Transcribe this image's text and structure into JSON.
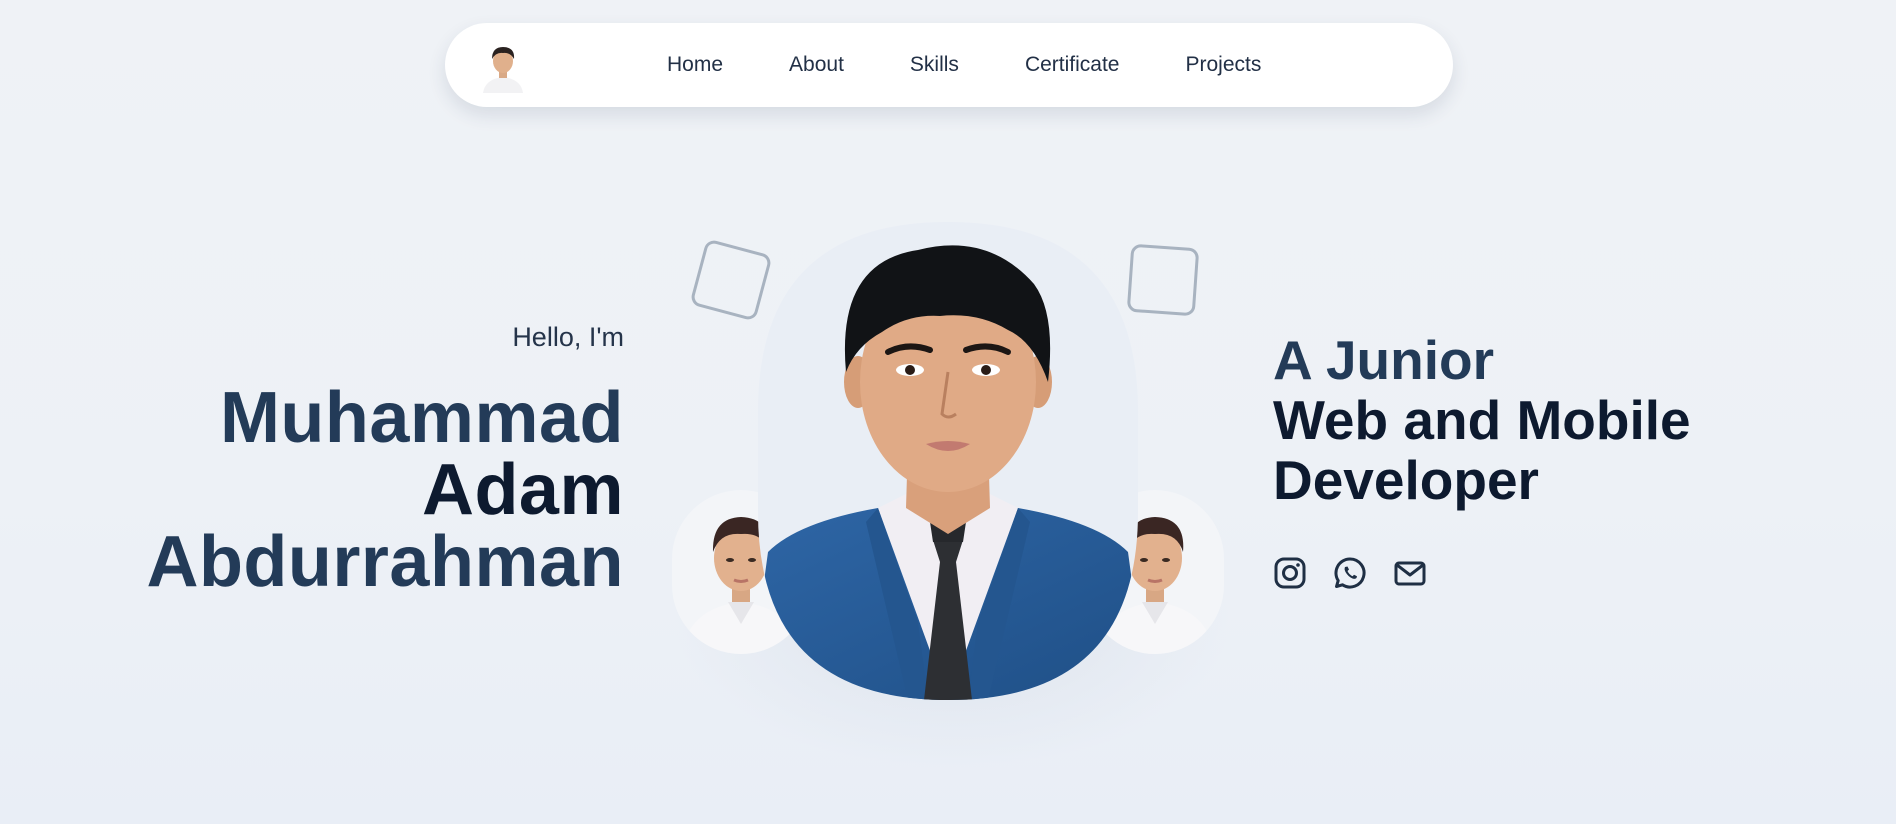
{
  "nav": {
    "avatar_icon": "profile-photo",
    "links": [
      "Home",
      "About",
      "Skills",
      "Certificate",
      "Projects"
    ]
  },
  "hero": {
    "greeting": "Hello, I'm",
    "name": {
      "first": "Muhammad",
      "middle": "Adam",
      "last": "Abdurrahman"
    },
    "role": {
      "line1": "A Junior",
      "line2": "Web and Mobile",
      "line3": "Developer"
    }
  },
  "socials": {
    "icons": [
      "instagram-icon",
      "whatsapp-icon",
      "mail-icon"
    ]
  },
  "colors": {
    "background": "#eef2f7",
    "navy": "#233b58",
    "dark_navy": "#0d1a2f",
    "suit_blue": "#2f66a3",
    "deco_gray": "#a8b3c0"
  }
}
